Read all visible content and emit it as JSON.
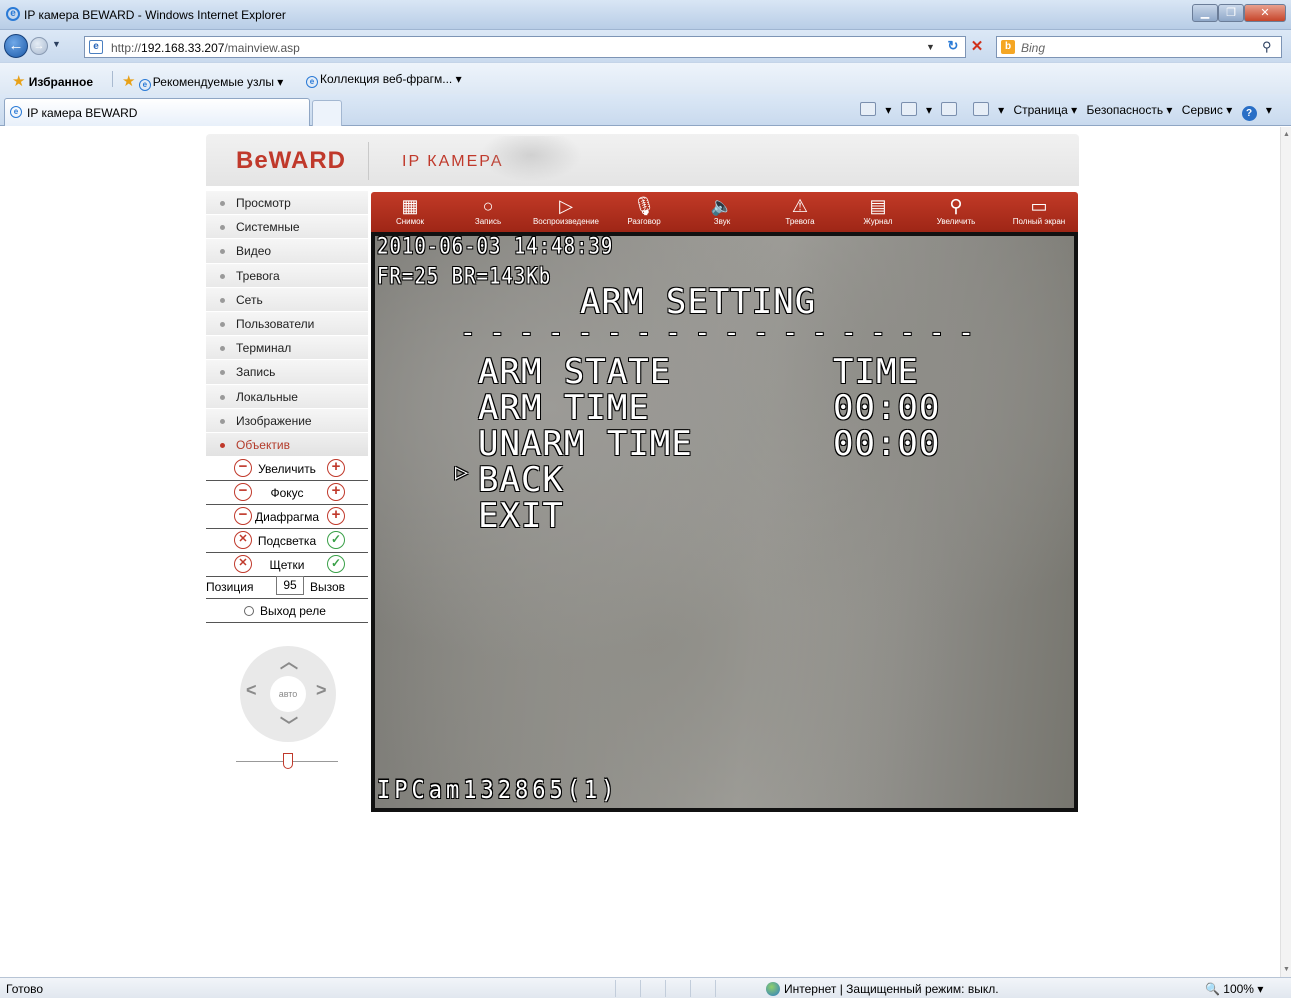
{
  "window": {
    "title": "IP камера BEWARD - Windows Internet Explorer"
  },
  "address": {
    "url_prefix": "http://",
    "url_host": "192.168.33.207",
    "url_path": "/mainview.asp",
    "search_placeholder": "Bing"
  },
  "favorites": {
    "label": "Избранное",
    "suggested": "Рекомендуемые узлы ▾",
    "gallery": "Коллекция веб-фрагм... ▾"
  },
  "tab": {
    "title": "IP камера BEWARD"
  },
  "commands": {
    "page": "Страница ▾",
    "safety": "Безопасность ▾",
    "tools": "Сервис ▾"
  },
  "status": {
    "left": "Готово",
    "zone": "Интернет | Защищенный режим: выкл.",
    "zoom": "100%"
  },
  "header": {
    "logo": "BeWARD",
    "product": "IP КАМЕРА"
  },
  "menu": {
    "items": [
      {
        "label": "Просмотр"
      },
      {
        "label": "Системные"
      },
      {
        "label": "Видео"
      },
      {
        "label": "Тревога"
      },
      {
        "label": "Сеть"
      },
      {
        "label": "Пользователи"
      },
      {
        "label": "Терминал"
      },
      {
        "label": "Запись"
      },
      {
        "label": "Локальные"
      },
      {
        "label": "Изображение"
      },
      {
        "label": "Объектив"
      }
    ],
    "active_index": 10
  },
  "lens": {
    "zoom": "Увеличить",
    "focus": "Фокус",
    "iris": "Диафрагма",
    "backlight": "Подсветка",
    "wiper": "Щетки",
    "position_label": "Позиция",
    "position_value": "95",
    "call_label": "Вызов",
    "relay_label": "Выход реле",
    "auto_label": "авто",
    "zoom_level": 0.5
  },
  "toolbar": {
    "snapshot": "Снимок",
    "record": "Запись",
    "playback": "Воспроизведение",
    "talk": "Разговор",
    "sound": "Звук",
    "alarm": "Тревога",
    "log": "Журнал",
    "zoom": "Увеличить",
    "fullscreen": "Полный экран"
  },
  "video": {
    "timestamp": "2010-06-03 14:48:39",
    "bitrate": "FR=25 BR=143Kb",
    "menu_title": "ARM SETTING",
    "divider": "- - - - - - - - - - - - - - - - - -",
    "rows": [
      {
        "label": "ARM STATE",
        "value": "TIME"
      },
      {
        "label": "ARM TIME",
        "value": "00:00"
      },
      {
        "label": "UNARM TIME",
        "value": "00:00"
      }
    ],
    "back": "BACK",
    "exit": "EXIT",
    "cursor": "▷",
    "camera_name": "IPCam132865(1)"
  }
}
